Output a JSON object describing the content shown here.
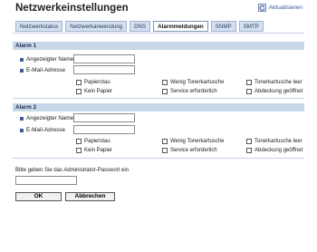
{
  "header": {
    "title": "Netzwerkeinstellungen",
    "refresh_label": "Aktualisieren"
  },
  "tabs": [
    {
      "label": "Netzwerkstatus",
      "active": false
    },
    {
      "label": "Netzwerkanwendung",
      "active": false
    },
    {
      "label": "DNS",
      "active": false
    },
    {
      "label": "Alarmmeldungen",
      "active": true
    },
    {
      "label": "SNMP",
      "active": false
    },
    {
      "label": "SMTP",
      "active": false
    }
  ],
  "alarm1": {
    "title": "Alarm 1",
    "name_label": "Angezeigter Name",
    "email_label": "E-Mail-Adresse",
    "name_value": "",
    "email_value": "",
    "options": [
      "Papierstau",
      "Wenig Tonerkartusche",
      "Tonerkartusche leer",
      "Kein Papier",
      "Service erforderlich",
      "Abdeckung geöffnet"
    ]
  },
  "alarm2": {
    "title": "Alarm 2",
    "name_label": "Angezeigter Name",
    "email_label": "E-Mail-Adresse",
    "name_value": "",
    "email_value": "",
    "options": [
      "Papierstau",
      "Wenig Tonerkartusche",
      "Tonerkartusche leer",
      "Kein Papier",
      "Service erforderlich",
      "Abdeckung geöffnet"
    ]
  },
  "password": {
    "label": "Bitte geben Sie das Administrator-Passwort ein",
    "value": ""
  },
  "buttons": {
    "ok": "OK",
    "cancel": "Abbrechen"
  },
  "colors": {
    "accent": "#3b5b9b",
    "section_bg": "#c8d6ea",
    "tab_bg": "#d4e0f0"
  }
}
